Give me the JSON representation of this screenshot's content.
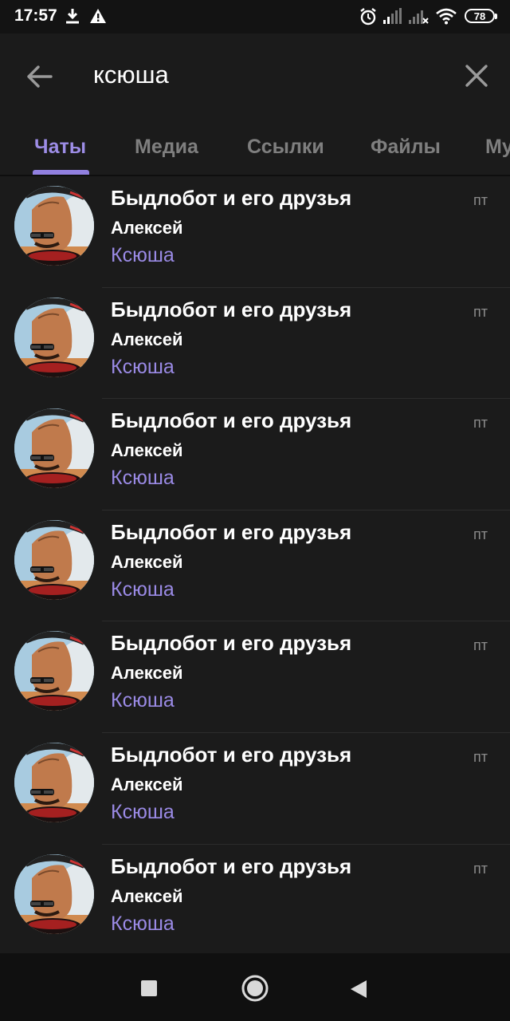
{
  "status_bar": {
    "time": "17:57",
    "battery": "78",
    "icons": [
      "download-icon",
      "warning-icon",
      "alarm-icon",
      "signal-icon",
      "signal-off-icon",
      "wifi-icon",
      "battery-icon"
    ]
  },
  "search": {
    "query": "ксюша",
    "back_icon": "arrow-left-icon",
    "clear_icon": "close-icon"
  },
  "tabs": [
    {
      "label": "Чаты",
      "active": true
    },
    {
      "label": "Медиа",
      "active": false
    },
    {
      "label": "Ссылки",
      "active": false
    },
    {
      "label": "Файлы",
      "active": false
    },
    {
      "label": "Му",
      "active": false
    }
  ],
  "chats": [
    {
      "title": "Быдлобот и его друзья",
      "sender": "Алексей",
      "snippet": "Ксюша",
      "date": "пт"
    },
    {
      "title": "Быдлобот и его друзья",
      "sender": "Алексей",
      "snippet": "Ксюша",
      "date": "пт"
    },
    {
      "title": "Быдлобот и его друзья",
      "sender": "Алексей",
      "snippet": "Ксюша",
      "date": "пт"
    },
    {
      "title": "Быдлобот и его друзья",
      "sender": "Алексей",
      "snippet": "Ксюша",
      "date": "пт"
    },
    {
      "title": "Быдлобот и его друзья",
      "sender": "Алексей",
      "snippet": "Ксюша",
      "date": "пт"
    },
    {
      "title": "Быдлобот и его друзья",
      "sender": "Алексей",
      "snippet": "Ксюша",
      "date": "пт"
    },
    {
      "title": "Быдлобот и его друзья",
      "sender": "Алексей",
      "snippet": "Ксюша",
      "date": "пт"
    }
  ],
  "nav_bar": {
    "icons": [
      "recents-square-icon",
      "home-circle-icon",
      "back-triangle-icon"
    ]
  },
  "colors": {
    "accent": "#9d8de6",
    "background": "#1b1b1b",
    "status_bar": "#131313",
    "nav_bar": "#101010"
  }
}
